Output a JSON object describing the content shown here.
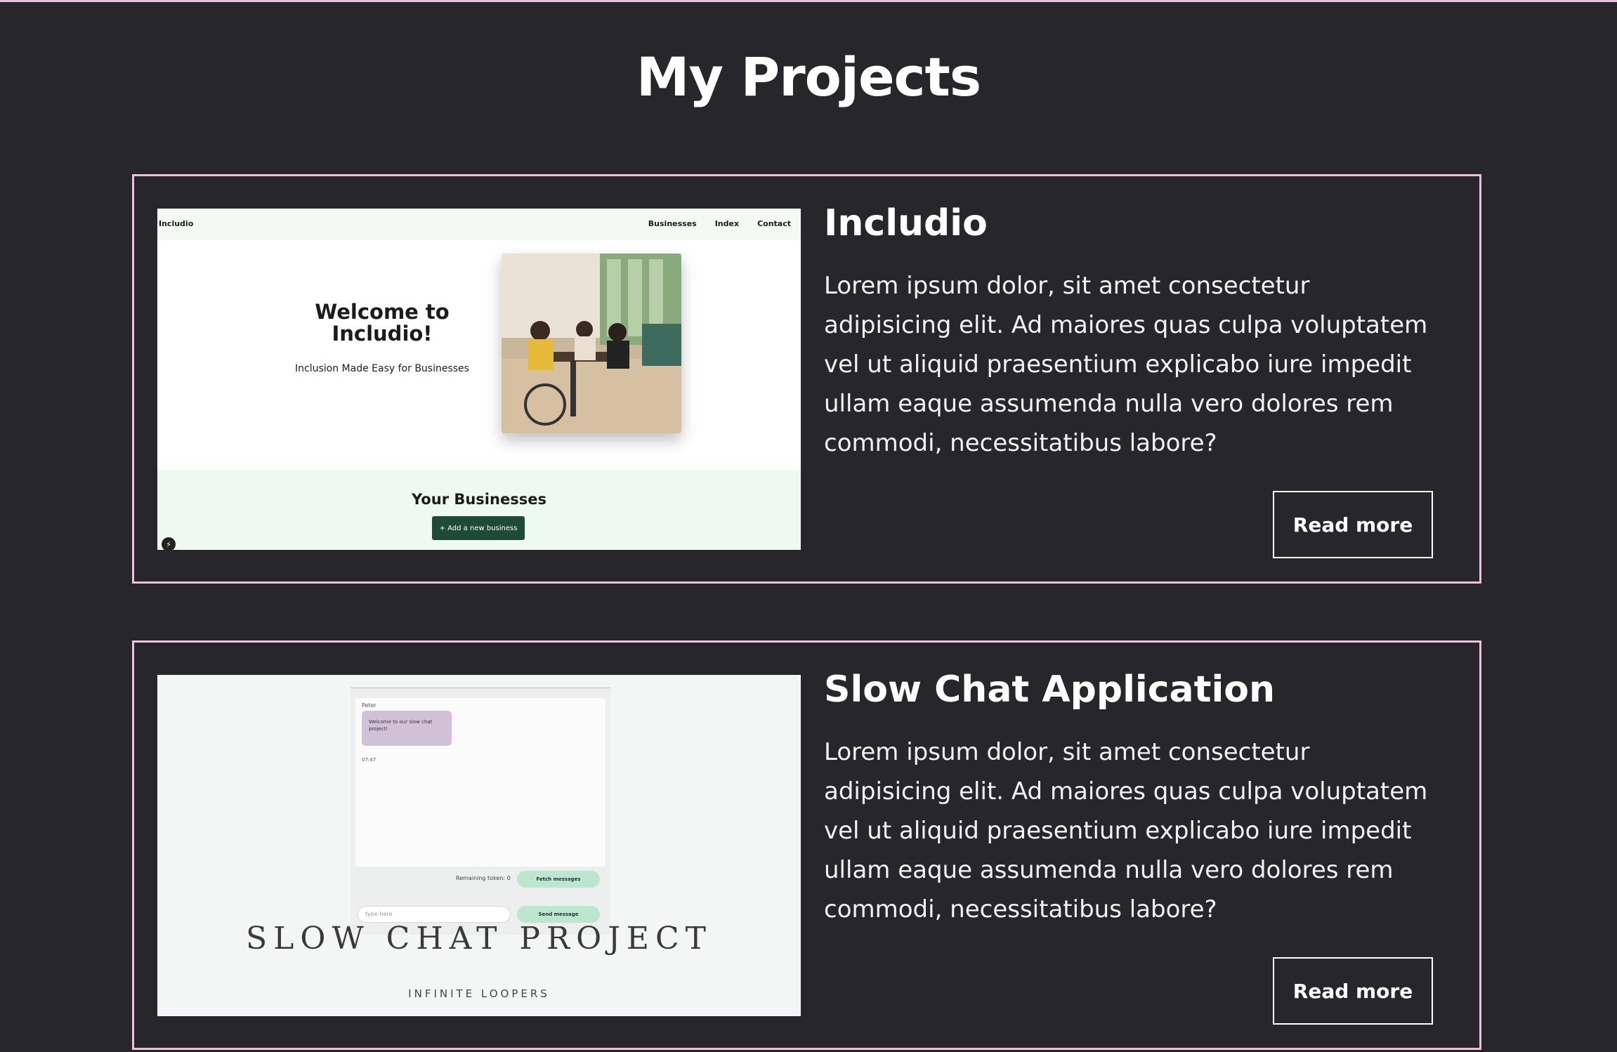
{
  "page": {
    "title": "My Projects"
  },
  "projects": [
    {
      "title": "Includio",
      "description": "Lorem ipsum dolor, sit amet consectetur adipisicing elit. Ad maiores quas culpa voluptatem vel ut aliquid praesentium explicabo iure impedit ullam eaque assumenda nulla vero dolores rem commodi, necessitatibus labore?",
      "button_label": "Read more",
      "screenshot": {
        "logo": "Includio",
        "nav_links": [
          "Businesses",
          "Index",
          "Contact"
        ],
        "hero_title": "Welcome to Includio!",
        "hero_subtitle": "Inclusion Made Easy for Businesses",
        "section_title": "Your Businesses",
        "add_button": "+ Add a new business"
      }
    },
    {
      "title": "Slow Chat Application",
      "description": "Lorem ipsum dolor, sit amet consectetur adipisicing elit. Ad maiores quas culpa voluptatem vel ut aliquid praesentium explicabo iure impedit ullam eaque assumenda nulla vero dolores rem commodi, necessitatibus labore?",
      "button_label": "Read more",
      "screenshot": {
        "sender": "Peter",
        "message": "Welcome to our slow chat project!",
        "time": "07:47",
        "tokens": "Remaining token: 0",
        "fetch_button": "Fetch messages",
        "input_placeholder": "type here",
        "send_button": "Send message",
        "project_title": "SLOW CHAT PROJECT",
        "project_subtitle": "INFINITE LOOPERS"
      }
    }
  ],
  "colors": {
    "background": "#27272b",
    "border": "#e8c3de",
    "text": "#ffffff"
  }
}
